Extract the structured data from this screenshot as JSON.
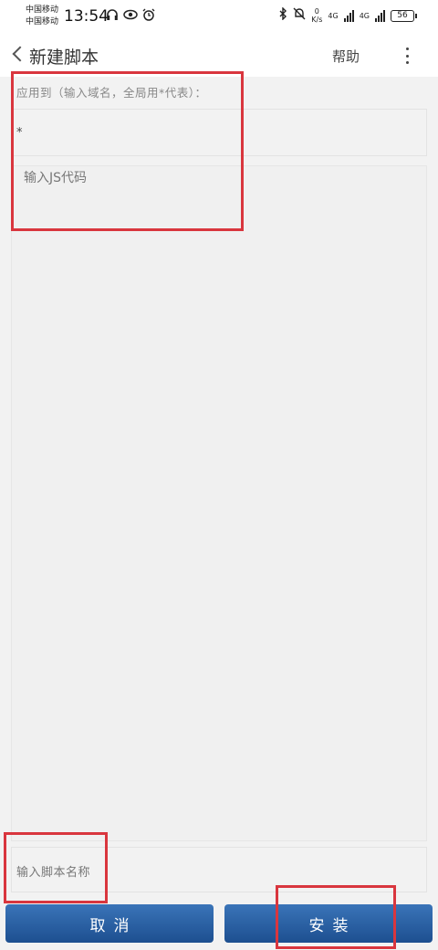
{
  "status_bar": {
    "carrier_1": "中国移动",
    "carrier_2": "中国移动",
    "time": "13:54",
    "net_speed_value": "0",
    "net_speed_unit": "K/s",
    "network_1": "4G",
    "network_2": "4G",
    "battery": "56"
  },
  "header": {
    "title": "新建脚本",
    "help_label": "帮助"
  },
  "form": {
    "apply_label": "应用到（输入域名，全局用*代表）：",
    "domain_value": "*",
    "code_placeholder": "输入JS代码",
    "name_placeholder": "输入脚本名称"
  },
  "buttons": {
    "cancel_label": "取消",
    "install_label": "安装"
  },
  "colors": {
    "button_top": "#3a74b8",
    "button_bottom": "#1d4f90",
    "highlight": "#d9363e"
  },
  "icons": [
    "headphones-icon",
    "eye-icon",
    "alarm-icon",
    "bluetooth-icon",
    "mute-icon",
    "signal-icon",
    "battery-icon",
    "back-chevron-icon",
    "more-vertical-icon"
  ]
}
